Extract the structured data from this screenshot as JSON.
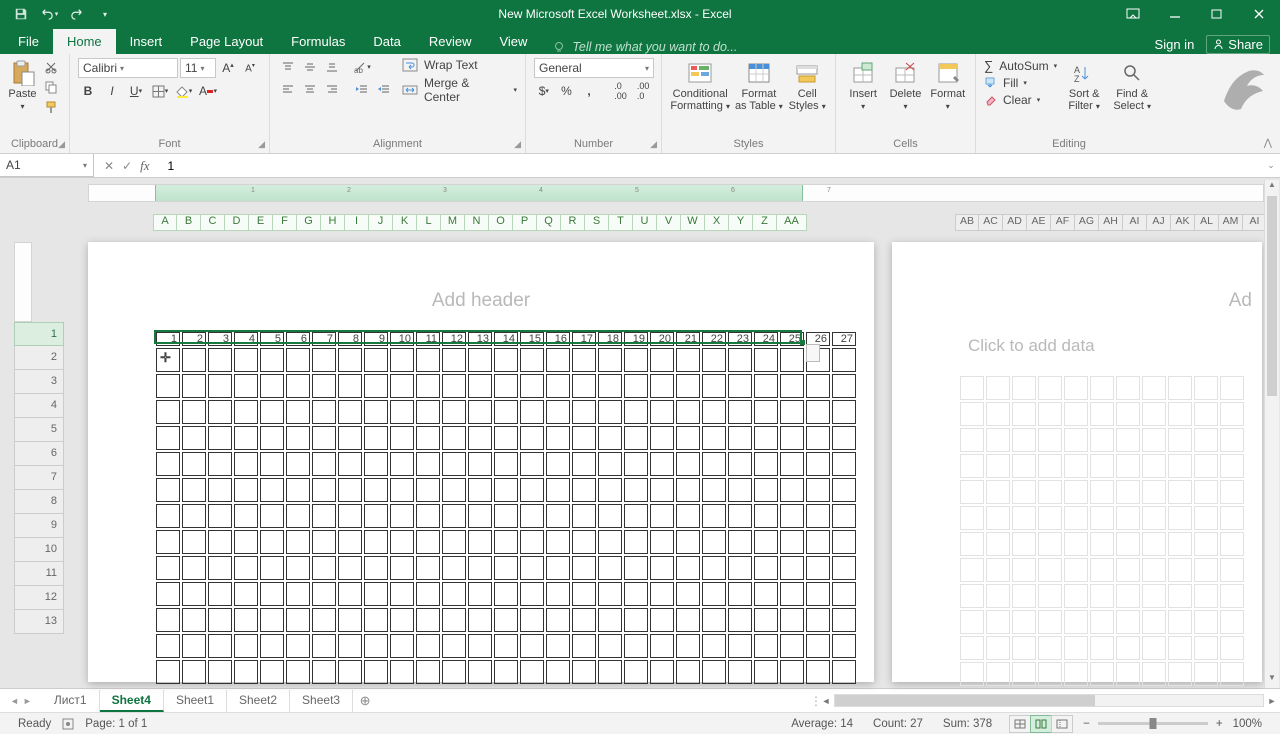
{
  "titlebar": {
    "title": "New Microsoft Excel Worksheet.xlsx - Excel"
  },
  "tabs": {
    "file": "File",
    "items": [
      "Home",
      "Insert",
      "Page Layout",
      "Formulas",
      "Data",
      "Review",
      "View"
    ],
    "active": "Home",
    "tellme": "Tell me what you want to do...",
    "signin": "Sign in",
    "share": "Share"
  },
  "ribbon": {
    "clipboard": {
      "label": "Clipboard",
      "paste": "Paste"
    },
    "font": {
      "label": "Font",
      "name": "Calibri",
      "size": "11"
    },
    "alignment": {
      "label": "Alignment",
      "wrap": "Wrap Text",
      "merge": "Merge & Center"
    },
    "number": {
      "label": "Number",
      "format": "General"
    },
    "styles": {
      "label": "Styles",
      "cond": "Conditional Formatting",
      "table": "Format as Table",
      "cell": "Cell Styles"
    },
    "cells": {
      "label": "Cells",
      "insert": "Insert",
      "delete": "Delete",
      "format": "Format"
    },
    "editing": {
      "label": "Editing",
      "autosum": "AutoSum",
      "fill": "Fill",
      "clear": "Clear",
      "sort": "Sort & Filter",
      "find": "Find & Select"
    }
  },
  "fbar": {
    "name": "A1",
    "formula": "1"
  },
  "col_letters": [
    "A",
    "B",
    "C",
    "D",
    "E",
    "F",
    "G",
    "H",
    "I",
    "J",
    "K",
    "L",
    "M",
    "N",
    "O",
    "P",
    "Q",
    "R",
    "S",
    "T",
    "U",
    "V",
    "W",
    "X",
    "Y",
    "Z",
    "AA"
  ],
  "col_letters2": [
    "AB",
    "AC",
    "AD",
    "AE",
    "AF",
    "AG",
    "AH",
    "AI",
    "AJ",
    "AK",
    "AL",
    "AM",
    "AI"
  ],
  "rows": [
    "1",
    "2",
    "3",
    "4",
    "5",
    "6",
    "7",
    "8",
    "9",
    "10",
    "11",
    "12",
    "13"
  ],
  "row1_values": [
    "1",
    "2",
    "3",
    "4",
    "5",
    "6",
    "7",
    "8",
    "9",
    "10",
    "11",
    "12",
    "13",
    "14",
    "15",
    "16",
    "17",
    "18",
    "19",
    "20",
    "21",
    "22",
    "23",
    "24",
    "25",
    "26",
    "27"
  ],
  "page1": {
    "addheader": "Add header"
  },
  "page2": {
    "ad": "Ad",
    "clickadd": "Click to add data"
  },
  "ruler_ticks": [
    "1",
    "2",
    "3",
    "4",
    "5",
    "6",
    "7"
  ],
  "sheets": [
    "Лист1",
    "Sheet4",
    "Sheet1",
    "Sheet2",
    "Sheet3"
  ],
  "active_sheet": "Sheet4",
  "status": {
    "ready": "Ready",
    "page": "Page: 1 of 1",
    "avg": "Average: 14",
    "count": "Count: 27",
    "sum": "Sum: 378",
    "zoom": "100%"
  }
}
